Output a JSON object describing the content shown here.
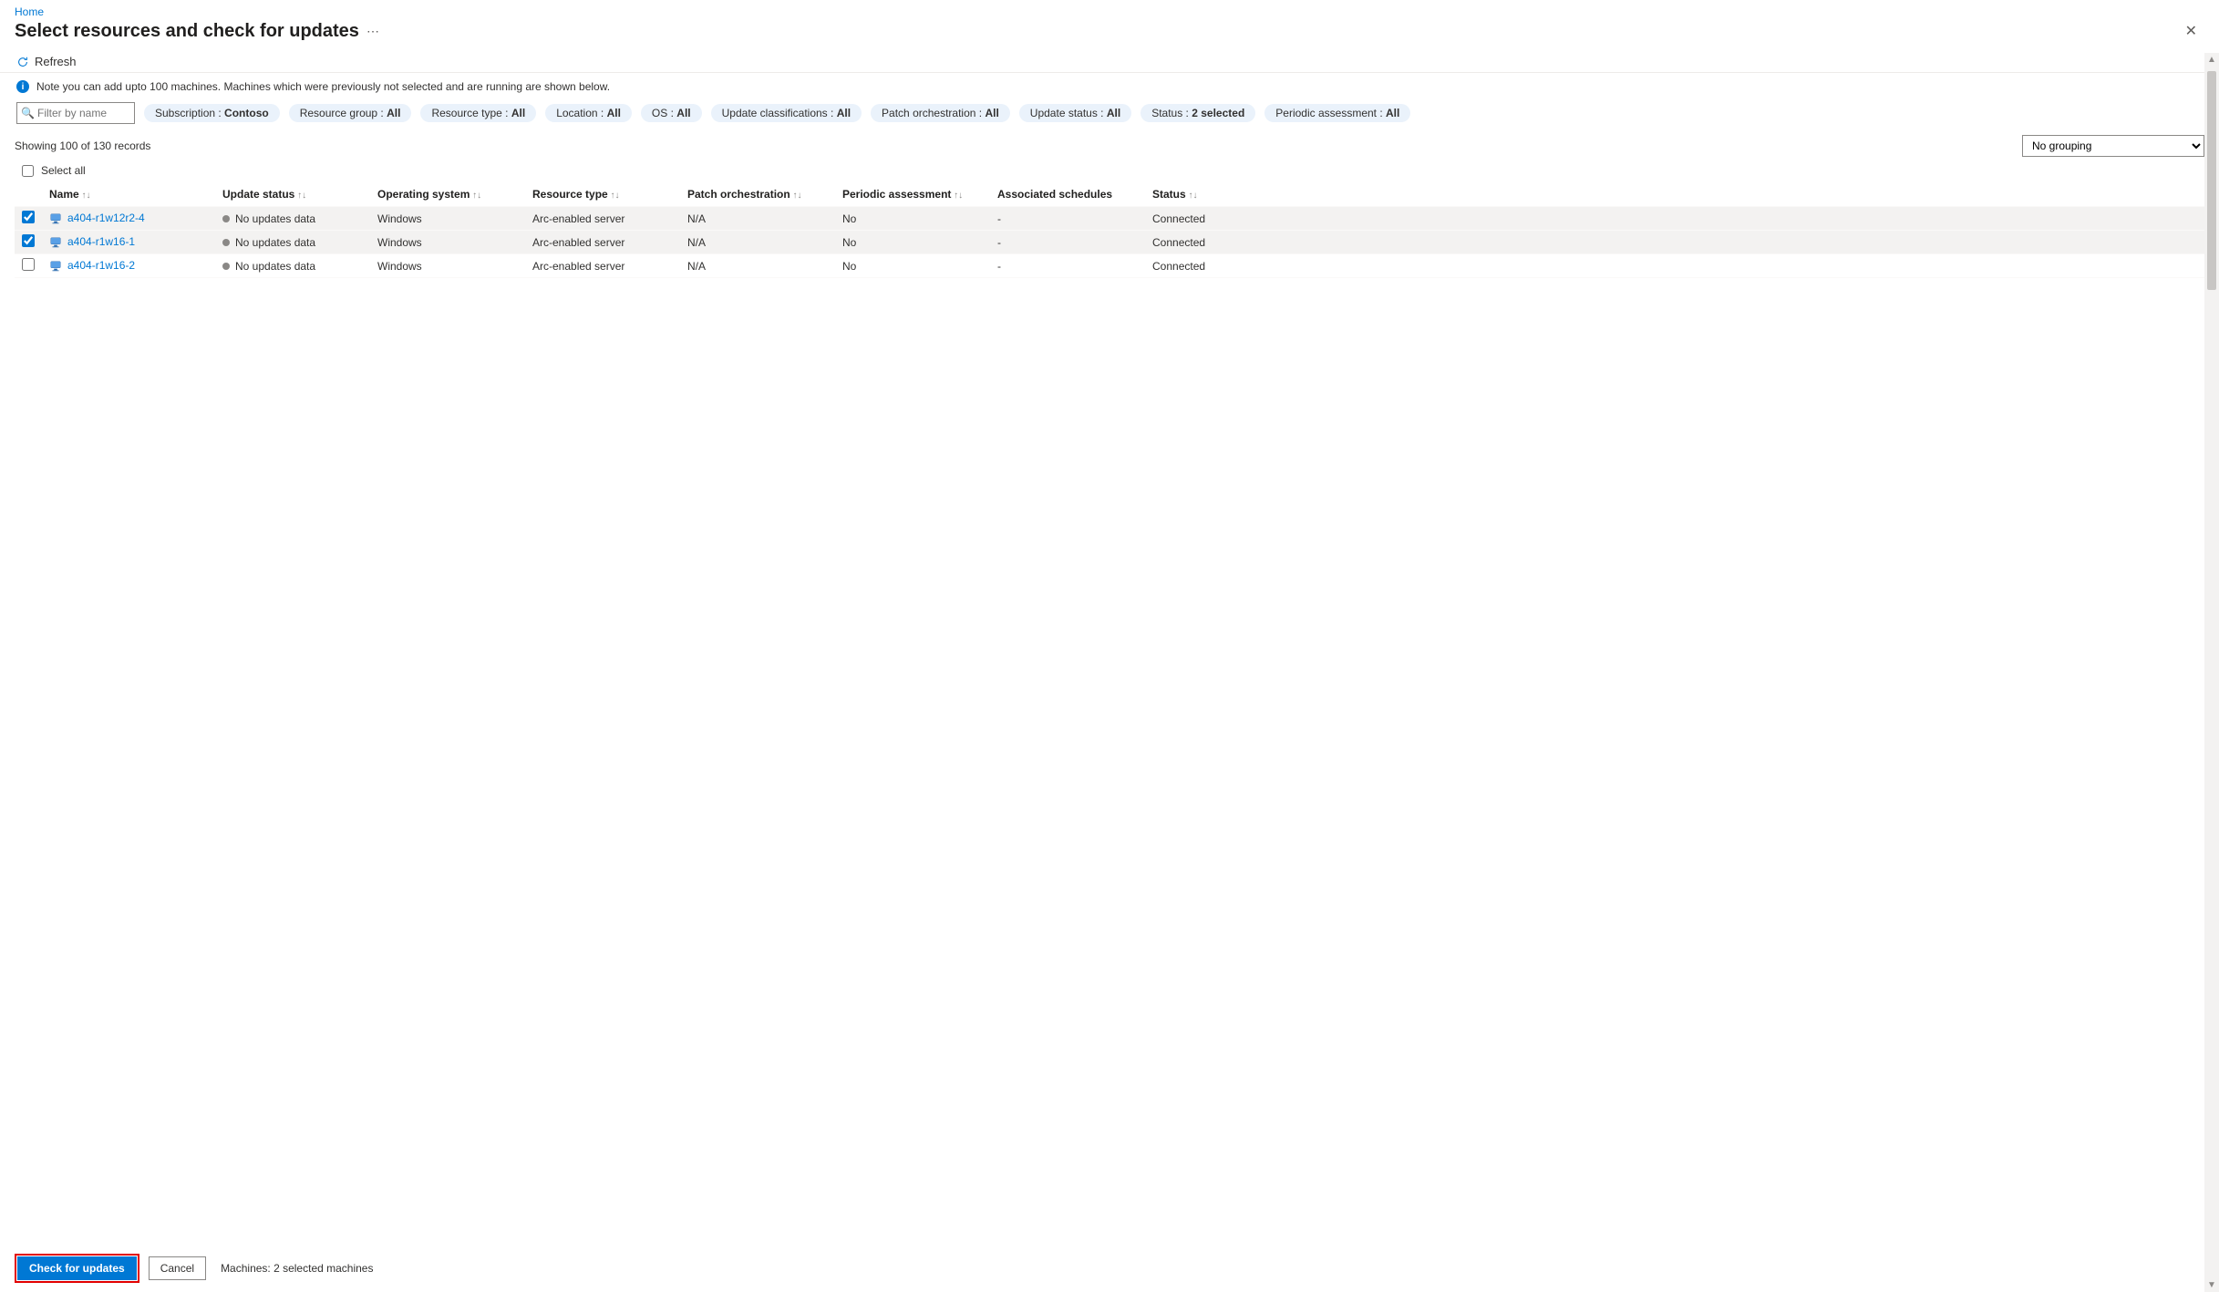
{
  "breadcrumb": {
    "home": "Home"
  },
  "page": {
    "title": "Select resources and check for updates"
  },
  "toolbar": {
    "refresh": "Refresh"
  },
  "info": {
    "text": "Note you can add upto 100 machines. Machines which were previously not selected and are running are shown below."
  },
  "filters": {
    "filter_placeholder": "Filter by name",
    "subscription_label": "Subscription :",
    "subscription_value": "Contoso",
    "resource_group_label": "Resource group :",
    "resource_group_value": "All",
    "resource_type_label": "Resource type :",
    "resource_type_value": "All",
    "location_label": "Location :",
    "location_value": "All",
    "os_label": "OS :",
    "os_value": "All",
    "update_class_label": "Update classifications :",
    "update_class_value": "All",
    "patch_orch_label": "Patch orchestration :",
    "patch_orch_value": "All",
    "update_status_label": "Update status :",
    "update_status_value": "All",
    "status_label": "Status :",
    "status_value": "2 selected",
    "periodic_label": "Periodic assessment :",
    "periodic_value": "All"
  },
  "summary": {
    "showing": "Showing 100 of 130 records",
    "grouping": "No grouping",
    "selectall": "Select all"
  },
  "columns": {
    "name": "Name",
    "update_status": "Update status",
    "os": "Operating system",
    "resource_type": "Resource type",
    "patch_orch": "Patch orchestration",
    "periodic": "Periodic assessment",
    "assoc": "Associated schedules",
    "status": "Status"
  },
  "rows": [
    {
      "checked": true,
      "name": "a404-r1w12r2-4",
      "update_status": "No updates data",
      "os": "Windows",
      "resource_type": "Arc-enabled server",
      "patch_orch": "N/A",
      "periodic": "No",
      "assoc": "-",
      "status": "Connected"
    },
    {
      "checked": true,
      "name": "a404-r1w16-1",
      "update_status": "No updates data",
      "os": "Windows",
      "resource_type": "Arc-enabled server",
      "patch_orch": "N/A",
      "periodic": "No",
      "assoc": "-",
      "status": "Connected"
    },
    {
      "checked": false,
      "name": "a404-r1w16-2",
      "update_status": "No updates data",
      "os": "Windows",
      "resource_type": "Arc-enabled server",
      "patch_orch": "N/A",
      "periodic": "No",
      "assoc": "-",
      "status": "Connected"
    }
  ],
  "footer": {
    "check": "Check for updates",
    "cancel": "Cancel",
    "status": "Machines: 2 selected machines"
  }
}
